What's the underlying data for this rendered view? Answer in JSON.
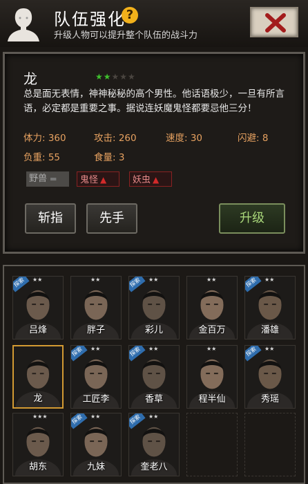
{
  "header": {
    "title": "队伍强化",
    "help_label": "?",
    "subtitle": "升级人物可以提升整个队伍的战斗力"
  },
  "detail": {
    "name": "龙",
    "stars_on": "★★",
    "stars_off": "★★★",
    "description": "总是面无表情，神神秘秘的高个男性。他话语极少，一旦有所言语，必定都是重要之事。据说连妖魔鬼怪都要忌他三分！",
    "stats": {
      "hp": "体力: 360",
      "attack": "攻击: 260",
      "speed": "速度: 30",
      "dodge": "闪避: 8",
      "load": "负重: 55",
      "food": "食量: 3"
    },
    "tags": [
      "野兽",
      "鬼怪",
      "妖虫"
    ],
    "buttons": {
      "cut": "斩指",
      "first": "先手",
      "upgrade": "升级"
    }
  },
  "roster": [
    {
      "name": "吕烽",
      "badge": "探索",
      "stars": "★★"
    },
    {
      "name": "胖子",
      "badge": "",
      "stars": "★★"
    },
    {
      "name": "彩儿",
      "badge": "探索",
      "stars": "★★"
    },
    {
      "name": "金百万",
      "badge": "",
      "stars": "★★"
    },
    {
      "name": "潘雄",
      "badge": "探索",
      "stars": "★★"
    },
    {
      "name": "龙",
      "badge": "",
      "stars": ""
    },
    {
      "name": "工匠李",
      "badge": "探索",
      "stars": "★★"
    },
    {
      "name": "香草",
      "badge": "探索",
      "stars": "★★"
    },
    {
      "name": "程半仙",
      "badge": "",
      "stars": "★★"
    },
    {
      "name": "秀瑶",
      "badge": "探索",
      "stars": "★★"
    },
    {
      "name": "胡东",
      "badge": "",
      "stars": "★★★"
    },
    {
      "name": "九妹",
      "badge": "探索",
      "stars": "★★"
    },
    {
      "name": "奎老八",
      "badge": "探索",
      "stars": "★★"
    }
  ],
  "colors": {
    "accent_orange": "#e6a160",
    "star_green": "#3fbf2e",
    "select_gold": "#d39a32",
    "badge_blue": "#2f6dad"
  }
}
